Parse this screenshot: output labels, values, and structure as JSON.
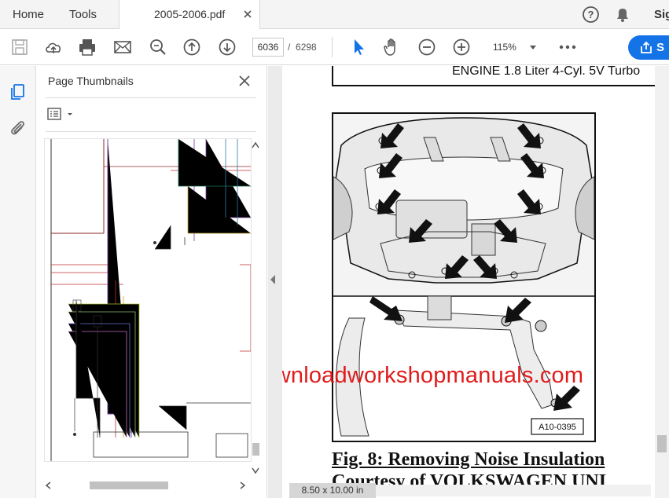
{
  "tabs": {
    "home": "Home",
    "tools": "Tools",
    "document": "2005-2006.pdf",
    "signin": "Sig"
  },
  "toolbar": {
    "current_page": "6036",
    "page_separator": "/",
    "total_pages": "6298",
    "zoom": "115%",
    "share_label": "S",
    "accent_color": "#1473e6",
    "icons": [
      "save-icon",
      "upload-cloud-icon",
      "print-icon",
      "mail-icon",
      "zoom-search-icon",
      "page-up-icon",
      "page-down-icon",
      "select-arrow-icon",
      "hand-icon",
      "zoom-out-icon",
      "zoom-in-icon",
      "more-icon"
    ]
  },
  "panel": {
    "title": "Page Thumbnails"
  },
  "document": {
    "engine_header": "ENGINE 1.8 Liter 4-Cyl. 5V Turbo",
    "figure_id": "A10-0395",
    "watermark": "www.downloadworkshopmanuals.com",
    "watermark_color": "#e01b1b",
    "caption": "Fig. 8: Removing Noise Insulation",
    "courtesy": "Courtesy of VOLKSWAGEN UNI",
    "page_size": "8.50 x 10.00 in"
  }
}
